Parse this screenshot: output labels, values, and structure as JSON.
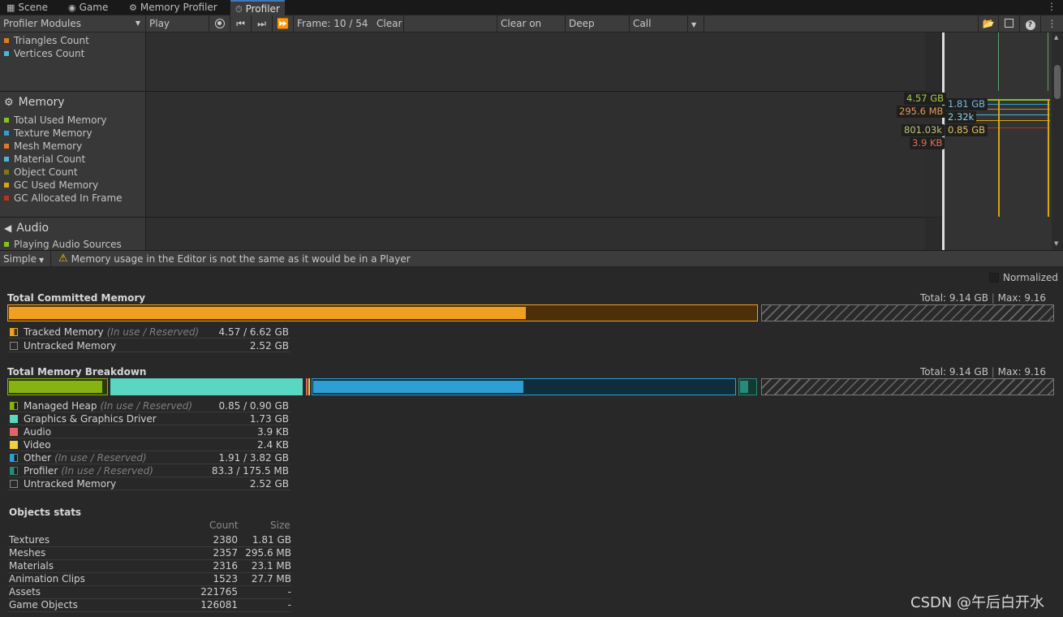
{
  "tabs": [
    {
      "label": "Scene",
      "icon": "grid-icon"
    },
    {
      "label": "Game",
      "icon": "gamepad-icon"
    },
    {
      "label": "Memory Profiler",
      "icon": "gear-icon"
    },
    {
      "label": "Profiler",
      "icon": "stopwatch-icon"
    }
  ],
  "toolbar": {
    "modules_label": "Profiler Modules",
    "play_mode": "Play Mode",
    "frame": "Frame: 10 / 54",
    "clear": "Clear",
    "clear_on_play": "Clear on Play",
    "deep_profile": "Deep Profile",
    "call_stacks": "Call Stacks"
  },
  "modules": {
    "rendering_legend": [
      {
        "label": "Triangles Count",
        "color": "#e07b22"
      },
      {
        "label": "Vertices Count",
        "color": "#4fb5d8"
      }
    ],
    "memory": {
      "title": "Memory",
      "legend": [
        {
          "label": "Total Used Memory",
          "color": "#85c21a"
        },
        {
          "label": "Texture Memory",
          "color": "#2e9fd4"
        },
        {
          "label": "Mesh Memory",
          "color": "#e07b22"
        },
        {
          "label": "Material Count",
          "color": "#4fb5d8"
        },
        {
          "label": "Object Count",
          "color": "#7a7a1a"
        },
        {
          "label": "GC Used Memory",
          "color": "#d8a514"
        },
        {
          "label": "GC Allocated In Frame",
          "color": "#b8341c"
        }
      ],
      "graph_labels": [
        {
          "text": "4.57 GB",
          "color": "#a8cf4a"
        },
        {
          "text": "295.6 MB",
          "color": "#e39a55"
        },
        {
          "text": "801.03k",
          "color": "#c2c27a"
        },
        {
          "text": "3.9 KB",
          "color": "#e0704f"
        },
        {
          "text": "1.81 GB",
          "color": "#78bce0"
        },
        {
          "text": "2.32k",
          "color": "#8fd0e8"
        },
        {
          "text": "0.85 GB",
          "color": "#e6c25a"
        }
      ]
    },
    "audio": {
      "title": "Audio",
      "legend": [
        {
          "label": "Playing Audio Sources",
          "color": "#85c21a"
        }
      ]
    }
  },
  "detail_bar": {
    "view": "Simple",
    "warning": "Memory usage in the Editor is not the same as it would be in a Player"
  },
  "normalized_label": "Normalized",
  "committed": {
    "title": "Total Committed Memory",
    "total": "Total: 9.14 GB",
    "max": "Max: 9.16 GB",
    "tracked_in_use_fraction": 0.69,
    "rows": [
      {
        "name": "Tracked Memory",
        "sub": "(In use / Reserved)",
        "value": "4.57 / 6.62 GB",
        "color": "#f0a020"
      },
      {
        "name": "Untracked Memory",
        "sub": "",
        "value": "2.52 GB",
        "color": "#444444"
      }
    ]
  },
  "breakdown": {
    "title": "Total Memory Breakdown",
    "total": "Total: 9.14 GB",
    "max": "Max: 9.16 GB",
    "rows": [
      {
        "name": "Managed Heap",
        "sub": "(In use / Reserved)",
        "value": "0.85 / 0.90 GB",
        "color": "#86b312"
      },
      {
        "name": "Graphics & Graphics Driver",
        "sub": "",
        "value": "1.73 GB",
        "color": "#5ad7c0"
      },
      {
        "name": "Audio",
        "sub": "",
        "value": "3.9 KB",
        "color": "#e06666"
      },
      {
        "name": "Video",
        "sub": "",
        "value": "2.4 KB",
        "color": "#f0d040"
      },
      {
        "name": "Other",
        "sub": "(In use / Reserved)",
        "value": "1.91 / 3.82 GB",
        "color": "#2e9fd4"
      },
      {
        "name": "Profiler",
        "sub": "(In use / Reserved)",
        "value": "83.3 / 175.5 MB",
        "color": "#2a8a78"
      },
      {
        "name": "Untracked Memory",
        "sub": "",
        "value": "2.52 GB",
        "color": "#444444"
      }
    ]
  },
  "objects": {
    "title": "Objects stats",
    "col_count": "Count",
    "col_size": "Size",
    "rows": [
      {
        "name": "Textures",
        "count": "2380",
        "size": "1.81 GB"
      },
      {
        "name": "Meshes",
        "count": "2357",
        "size": "295.6 MB"
      },
      {
        "name": "Materials",
        "count": "2316",
        "size": "23.1 MB"
      },
      {
        "name": "Animation Clips",
        "count": "1523",
        "size": "27.7 MB"
      },
      {
        "name": "Assets",
        "count": "221765",
        "size": "-"
      },
      {
        "name": "Game Objects",
        "count": "126081",
        "size": "-"
      }
    ]
  },
  "watermark": "CSDN @午后白开水"
}
